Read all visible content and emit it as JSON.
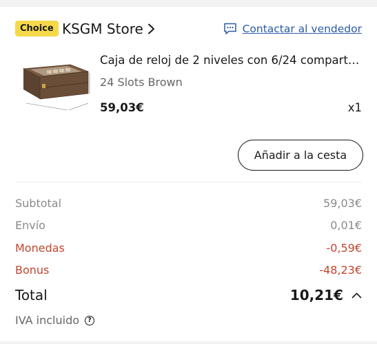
{
  "store": {
    "badge": "Choice",
    "name": "KSGM Store",
    "contact_label": "Contactar al vendedor"
  },
  "product": {
    "title": "Caja de reloj de 2 niveles con 6/24 comparti…",
    "variant": "24 Slots Brown",
    "price": "59,03€",
    "quantity": "x1",
    "add_to_cart_label": "Añadir a la cesta"
  },
  "summary": {
    "subtotal_label": "Subtotal",
    "subtotal_value": "59,03€",
    "shipping_label": "Envío",
    "shipping_value": "0,01€",
    "coins_label": "Monedas",
    "coins_value": "-0,59€",
    "bonus_label": "Bonus",
    "bonus_value": "-48,23€",
    "total_label": "Total",
    "total_value": "10,21€",
    "tax_note": "IVA incluido"
  },
  "icons": {
    "store_chevron": "chevron-right-icon",
    "contact": "chat-bubble-icon",
    "total_toggle": "chevron-up-icon",
    "tax_help": "question-circle-icon"
  },
  "colors": {
    "choice_badge": "#f5d94a",
    "link": "#2a5aa9",
    "discount": "#c2452d",
    "muted": "#8a8a8a"
  }
}
